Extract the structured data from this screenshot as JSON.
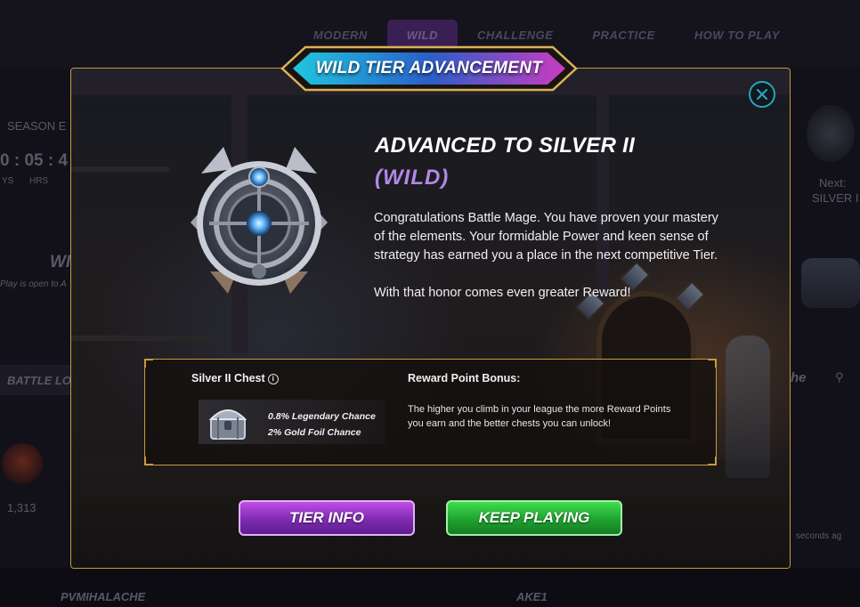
{
  "background": {
    "tabs": [
      {
        "label": "MODERN",
        "active": false
      },
      {
        "label": "WILD",
        "active": true
      },
      {
        "label": "CHALLENGE",
        "active": false
      },
      {
        "label": "PRACTICE",
        "active": false
      },
      {
        "label": "HOW TO PLAY",
        "active": false
      }
    ],
    "season_label": "SEASON E",
    "timer": "0 : 05 : 4",
    "timer_units": [
      "YS",
      "HRS"
    ],
    "left_heading": "WI",
    "left_sub": "Play is open to A",
    "battle_log": "BATTLE LO",
    "rating": "1,313",
    "next_label": "Next:",
    "next_value": "SILVER I",
    "right_heading": "he",
    "right_time": "seconds ag",
    "bottom_left_name": "PVMIHALACHE",
    "bottom_mid_name": "AKE1"
  },
  "modal": {
    "banner_title": "WILD TIER ADVANCEMENT",
    "title": "ADVANCED TO SILVER II",
    "subtitle": "(WILD)",
    "paragraph1": "Congratulations Battle Mage. You have proven your mastery of the elements. Your formidable Power and keen sense of strategy has earned you a place in the next competitive Tier.",
    "paragraph2": "With that honor comes even greater Reward!",
    "reward": {
      "chest_label": "Silver II Chest",
      "info_icon_glyph": "i",
      "legendary_chance": "0.8% Legendary Chance",
      "gold_foil_chance": "2% Gold Foil Chance",
      "bonus_label": "Reward Point Bonus:",
      "bonus_text": "The higher you climb in your league the more Reward Points you earn and the better chests you can unlock!"
    },
    "buttons": {
      "tier_info": "TIER INFO",
      "keep_playing": "KEEP PLAYING"
    },
    "colors": {
      "frame_gold": "#c79a3e",
      "subtitle_purple": "#b188e6",
      "close_teal": "#2aa5b8",
      "banner_cyan": "#1fc7e0",
      "banner_magenta": "#c93cc0"
    },
    "icons": [
      "close-icon",
      "silver-tier-emblem-icon",
      "silver-chest-icon",
      "info-icon"
    ]
  }
}
